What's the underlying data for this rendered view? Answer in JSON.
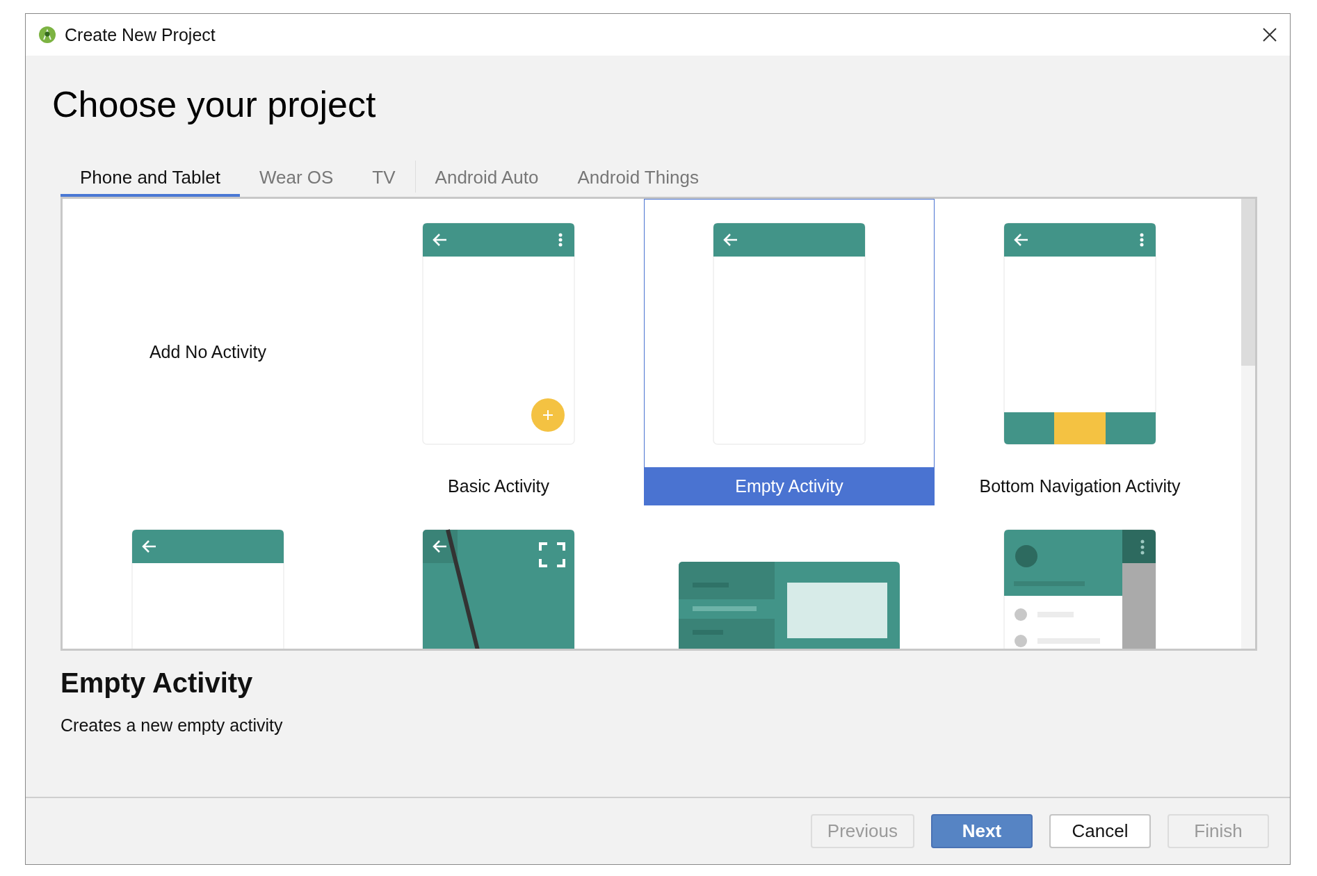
{
  "window": {
    "title": "Create New Project"
  },
  "heading": "Choose your project",
  "tabs": [
    {
      "label": "Phone and Tablet",
      "selected": true
    },
    {
      "label": "Wear OS",
      "selected": false
    },
    {
      "label": "TV",
      "selected": false
    },
    {
      "label": "Android Auto",
      "selected": false
    },
    {
      "label": "Android Things",
      "selected": false
    }
  ],
  "templates": [
    {
      "name": "Add No Activity",
      "kind": "none",
      "selected": false
    },
    {
      "name": "Basic Activity",
      "kind": "basic",
      "selected": false
    },
    {
      "name": "Empty Activity",
      "kind": "empty",
      "selected": true
    },
    {
      "name": "Bottom Navigation Activity",
      "kind": "bottom_nav",
      "selected": false
    },
    {
      "kind": "plain",
      "selected": false
    },
    {
      "kind": "fullscreen",
      "selected": false
    },
    {
      "kind": "master_detail",
      "selected": false
    },
    {
      "kind": "nav_drawer",
      "selected": false
    }
  ],
  "description": {
    "title": "Empty Activity",
    "text": "Creates a new empty activity"
  },
  "buttons": [
    {
      "label": "Previous",
      "kind": "secondary",
      "disabled": true
    },
    {
      "label": "Next",
      "kind": "primary",
      "disabled": false
    },
    {
      "label": "Cancel",
      "kind": "secondary",
      "disabled": false
    },
    {
      "label": "Finish",
      "kind": "secondary",
      "disabled": true
    }
  ]
}
